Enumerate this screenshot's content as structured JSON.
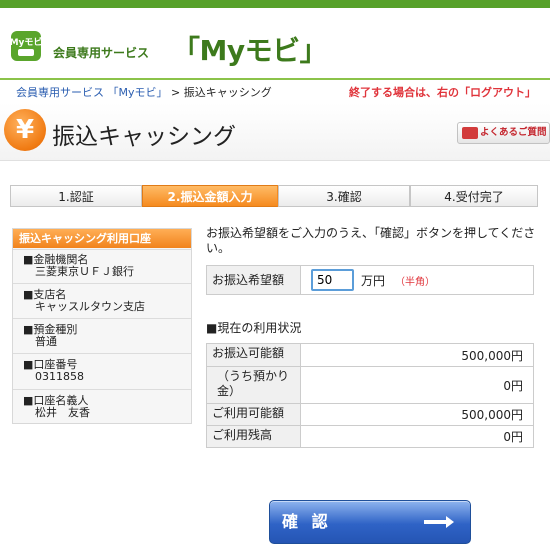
{
  "header": {
    "brand_sub": "会員専用サービス",
    "brand_main": "「Myモビ」",
    "logo_text": "Myモビ"
  },
  "breadcrumb": {
    "home": "会員専用サービス 「Myモビ」",
    "sep": ">",
    "current": "振込キャッシング",
    "notice": "終了する場合は、右の「ログアウト」"
  },
  "title": {
    "icon_glyph": "¥",
    "text": "振込キャッシング",
    "faq_label": "よくあるご質問"
  },
  "steps": [
    {
      "label": "1.認証",
      "active": false
    },
    {
      "label": "2.振込金額入力",
      "active": true
    },
    {
      "label": "3.確認",
      "active": false
    },
    {
      "label": "4.受付完了",
      "active": false
    }
  ],
  "account": {
    "heading": "振込キャッシング利用口座",
    "items": [
      {
        "label": "■金融機関名",
        "value": "三菱東京ＵＦＪ銀行"
      },
      {
        "label": "■支店名",
        "value": "キャッスルタウン支店"
      },
      {
        "label": "■預金種別",
        "value": "普通"
      },
      {
        "label": "■口座番号",
        "value": "0311858"
      },
      {
        "label": "■口座名義人",
        "value": "松井　友香"
      }
    ]
  },
  "form": {
    "instruction": "お振込希望額をご入力のうえ、「確認」ボタンを押してください。",
    "amount_label": "お振込希望額",
    "amount_value": "50",
    "unit": "万円",
    "hint": "（半角）"
  },
  "status": {
    "heading": "■現在の利用状況",
    "rows": [
      {
        "label": "お振込可能額",
        "value": "500,000円"
      },
      {
        "label": "（うち預かり金）",
        "value": "0円"
      },
      {
        "label": "ご利用可能額",
        "value": "500,000円"
      },
      {
        "label": "ご利用残高",
        "value": "0円"
      }
    ]
  },
  "confirm_label": "確 認",
  "colors": {
    "brand_green": "#57a12a",
    "accent_orange": "#f58a1f",
    "notice_red": "#e0353c",
    "button_blue": "#2f63c6"
  }
}
